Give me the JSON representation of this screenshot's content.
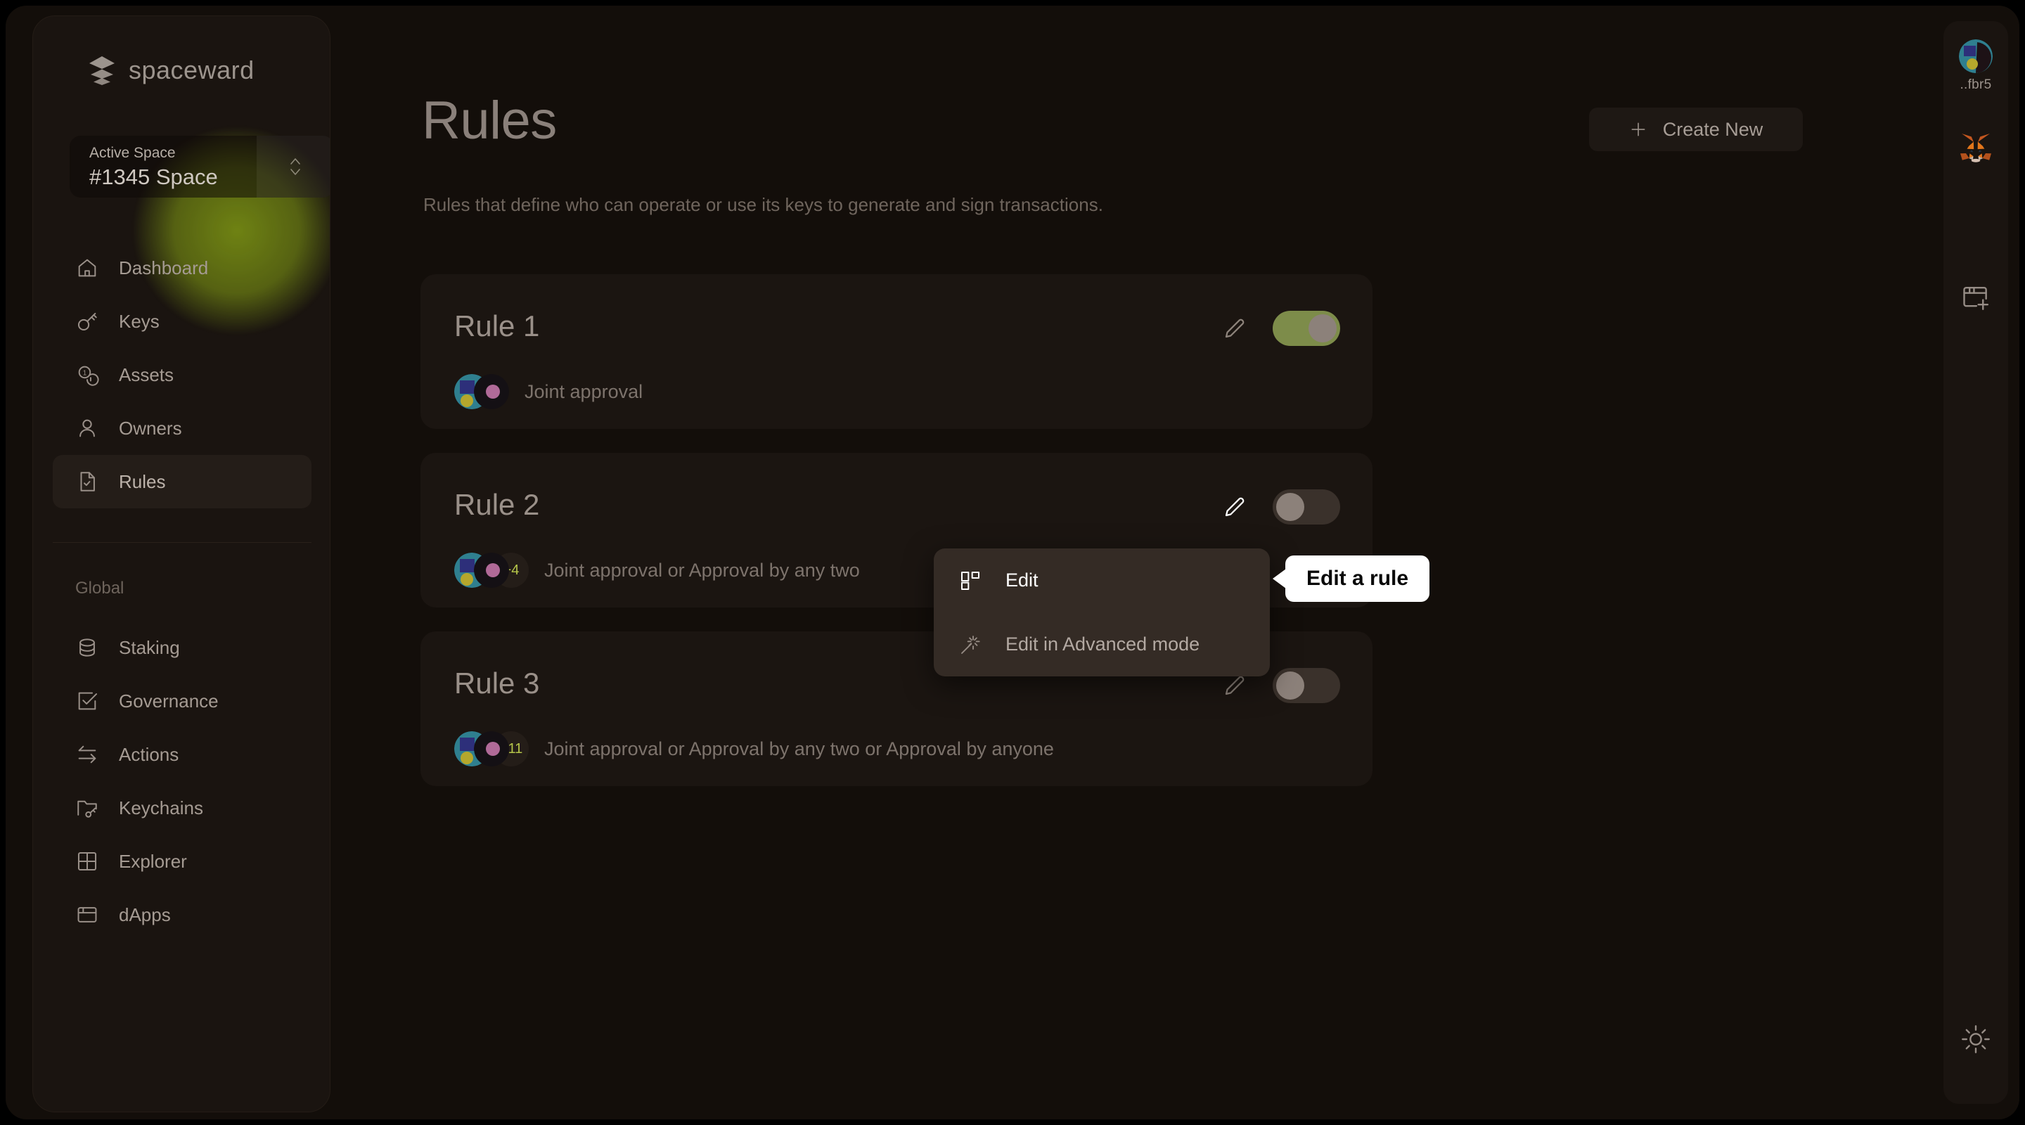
{
  "brand": {
    "name": "spaceward",
    "logo_icon": "spaceward-chevrons-logo"
  },
  "space_switcher": {
    "label": "Active Space",
    "value": "#1345 Space",
    "chevron_icon": "chevron-up-down-icon"
  },
  "sidebar": {
    "items": [
      {
        "label": "Dashboard",
        "icon": "home-icon",
        "active": false
      },
      {
        "label": "Keys",
        "icon": "key-icon",
        "active": false
      },
      {
        "label": "Assets",
        "icon": "coins-icon",
        "active": false
      },
      {
        "label": "Owners",
        "icon": "user-icon",
        "active": false
      },
      {
        "label": "Rules",
        "icon": "document-check-icon",
        "active": true
      }
    ],
    "global_heading": "Global",
    "global_items": [
      {
        "label": "Staking",
        "icon": "database-icon",
        "active": false
      },
      {
        "label": "Governance",
        "icon": "checkbox-checked-icon",
        "active": false
      },
      {
        "label": "Actions",
        "icon": "arrows-exchange-icon",
        "active": false
      },
      {
        "label": "Keychains",
        "icon": "folder-key-icon",
        "active": false
      },
      {
        "label": "Explorer",
        "icon": "grid-icon",
        "active": false
      },
      {
        "label": "dApps",
        "icon": "browser-window-icon",
        "active": false
      }
    ]
  },
  "header": {
    "title": "Rules",
    "subtitle": "Rules that define who can operate or use its keys to generate and sign transactions.",
    "create_button": {
      "label": "Create New",
      "icon": "plus-icon"
    }
  },
  "rules": [
    {
      "title": "Rule 1",
      "description": "Joint approval",
      "enabled": true,
      "extra_count": "",
      "edit_icon": "pencil-icon",
      "edit_icon_highlighted": false,
      "avatars": [
        "#2f7f8f",
        "#141014"
      ]
    },
    {
      "title": "Rule 2",
      "description": "Joint approval or Approval by any two",
      "enabled": false,
      "extra_count": "+4",
      "edit_icon": "pencil-icon",
      "edit_icon_highlighted": true,
      "avatars": [
        "#2f7f8f",
        "#141014"
      ]
    },
    {
      "title": "Rule 3",
      "description": "Joint approval or Approval by any two or Approval by anyone",
      "enabled": false,
      "extra_count": "+11",
      "edit_icon": "pencil-icon",
      "edit_icon_highlighted": false,
      "avatars": [
        "#2f7f8f",
        "#141014"
      ]
    }
  ],
  "context_menu": {
    "items": [
      {
        "label": "Edit",
        "icon": "blocks-icon",
        "state": "primary"
      },
      {
        "label": "Edit in Advanced mode",
        "icon": "magic-wand-icon",
        "state": "muted"
      }
    ]
  },
  "tooltip": {
    "text": "Edit a rule"
  },
  "extensions_rail": {
    "account_label": "..fbr5",
    "account_icon": "account-avatar-icon",
    "metamask_icon": "metamask-fox-icon",
    "new_window_icon": "new-window-icon",
    "theme_icon": "sun-icon"
  },
  "colors": {
    "accent_green": "#7d8c4a",
    "badge_green": "#b6c64a",
    "panel": "#1b1511",
    "sidebar": "#1a1410",
    "page_bg": "#130e0a",
    "menu_bg": "#342b25",
    "tooltip_bg": "#ffffff"
  }
}
